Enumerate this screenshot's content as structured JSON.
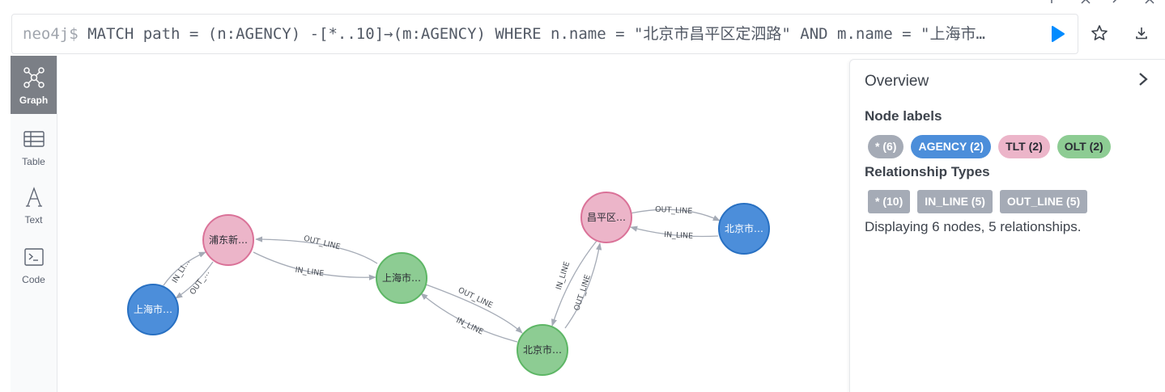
{
  "editor": {
    "prompt": "neo4j$",
    "query": " MATCH path = (n:AGENCY) -[*..10]→(m:AGENCY) WHERE n.name = \"北京市昌平区定泗路\" AND m.name = \"上海市…"
  },
  "sidebar": {
    "items": [
      {
        "label": "Graph",
        "icon": "graph-icon",
        "active": true
      },
      {
        "label": "Table",
        "icon": "table-icon",
        "active": false
      },
      {
        "label": "Text",
        "icon": "text-icon",
        "active": false
      },
      {
        "label": "Code",
        "icon": "code-icon",
        "active": false
      }
    ]
  },
  "graph": {
    "colors": {
      "agency": "#4c8eda",
      "tlt": "#ecb5c9",
      "olt": "#8dcc93",
      "edge": "#a5abb6"
    },
    "nodes": [
      {
        "id": "n1",
        "label": "浦东新…",
        "type": "tlt"
      },
      {
        "id": "n2",
        "label": "上海市…",
        "type": "agency"
      },
      {
        "id": "n3",
        "label": "上海市…",
        "type": "olt"
      },
      {
        "id": "n4",
        "label": "北京市…",
        "type": "olt"
      },
      {
        "id": "n5",
        "label": "昌平区…",
        "type": "tlt"
      },
      {
        "id": "n6",
        "label": "北京市…",
        "type": "agency"
      }
    ],
    "edges": [
      {
        "id": "e1",
        "label": "OUT_LINE"
      },
      {
        "id": "e2",
        "label": "IN_LINE"
      },
      {
        "id": "e3",
        "label": "IN_LI…"
      },
      {
        "id": "e4",
        "label": "OUT_…"
      },
      {
        "id": "e5",
        "label": "OUT_LINE"
      },
      {
        "id": "e6",
        "label": "IN_LINE"
      },
      {
        "id": "e7",
        "label": "IN_LINE"
      },
      {
        "id": "e8",
        "label": "OUT_LINE"
      },
      {
        "id": "e9",
        "label": "OUT_LINE"
      },
      {
        "id": "e10",
        "label": "IN_LINE"
      }
    ]
  },
  "overview": {
    "title": "Overview",
    "node_labels_heading": "Node labels",
    "node_labels": [
      {
        "text": "* (6)",
        "bg": "#a5abb6",
        "fg": "#ffffff"
      },
      {
        "text": "AGENCY (2)",
        "bg": "#4c8eda",
        "fg": "#ffffff"
      },
      {
        "text": "TLT (2)",
        "bg": "#ecb5c9",
        "fg": "#2a2c34"
      },
      {
        "text": "OLT (2)",
        "bg": "#8dcc93",
        "fg": "#2a2c34"
      }
    ],
    "rel_types_heading": "Relationship Types",
    "rel_types": [
      {
        "text": "* (10)",
        "bg": "#a5abb6",
        "fg": "#ffffff"
      },
      {
        "text": "IN_LINE (5)",
        "bg": "#a5abb6",
        "fg": "#ffffff"
      },
      {
        "text": "OUT_LINE (5)",
        "bg": "#a5abb6",
        "fg": "#ffffff"
      }
    ],
    "status": "Displaying 6 nodes, 5 relationships."
  }
}
